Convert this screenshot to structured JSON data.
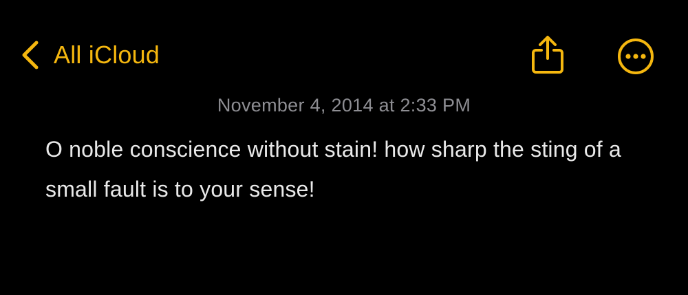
{
  "colors": {
    "accent": "#f5b70f",
    "background": "#000000",
    "text": "#e9e9e9",
    "secondary_text": "#8e8e93"
  },
  "nav": {
    "back_label": "All iCloud",
    "back_icon": "chevron-left-icon",
    "share_icon": "share-icon",
    "more_icon": "ellipsis-circle-icon"
  },
  "note": {
    "date": "November 4, 2014 at 2:33 PM",
    "body": "O noble conscience without stain! how sharp the sting of a small fault is to your sense!"
  }
}
